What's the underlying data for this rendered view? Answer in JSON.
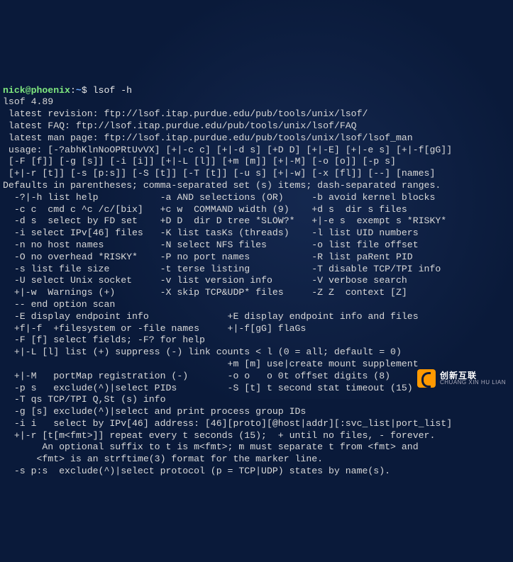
{
  "prompt": {
    "user": "nick@phoenix",
    "sep": ":",
    "path": "~",
    "sigil": "$ ",
    "command": "lsof -h"
  },
  "lines": [
    "lsof 4.89",
    " latest revision: ftp://lsof.itap.purdue.edu/pub/tools/unix/lsof/",
    " latest FAQ: ftp://lsof.itap.purdue.edu/pub/tools/unix/lsof/FAQ",
    " latest man page: ftp://lsof.itap.purdue.edu/pub/tools/unix/lsof/lsof_man",
    " usage: [-?abhKlnNoOPRtUvVX] [+|-c c] [+|-d s] [+D D] [+|-E] [+|-e s] [+|-f[gG]]",
    " [-F [f]] [-g [s]] [-i [i]] [+|-L [l]] [+m [m]] [+|-M] [-o [o]] [-p s]",
    " [+|-r [t]] [-s [p:s]] [-S [t]] [-T [t]] [-u s] [+|-w] [-x [fl]] [--] [names]",
    "Defaults in parentheses; comma-separated set (s) items; dash-separated ranges.",
    "  -?|-h list help           -a AND selections (OR)     -b avoid kernel blocks",
    "  -c c  cmd c ^c /c/[bix]   +c w  COMMAND width (9)    +d s  dir s files",
    "  -d s  select by FD set    +D D  dir D tree *SLOW?*   +|-e s  exempt s *RISKY*",
    "  -i select IPv[46] files   -K list tasKs (threads)    -l list UID numbers",
    "  -n no host names          -N select NFS files        -o list file offset",
    "  -O no overhead *RISKY*    -P no port names           -R list paRent PID",
    "  -s list file size         -t terse listing           -T disable TCP/TPI info",
    "  -U select Unix socket     -v list version info       -V verbose search",
    "  +|-w  Warnings (+)        -X skip TCP&UDP* files     -Z Z  context [Z]",
    "  -- end option scan",
    "  -E display endpoint info              +E display endpoint info and files",
    "  +f|-f  +filesystem or -file names     +|-f[gG] flaGs",
    "  -F [f] select fields; -F? for help",
    "  +|-L [l] list (+) suppress (-) link counts < l (0 = all; default = 0)",
    "                                        +m [m] use|create mount supplement",
    "  +|-M   portMap registration (-)       -o o   o 0t offset digits (8)",
    "  -p s   exclude(^)|select PIDs         -S [t] t second stat timeout (15)",
    "  -T qs TCP/TPI Q,St (s) info",
    "  -g [s] exclude(^)|select and print process group IDs",
    "  -i i   select by IPv[46] address: [46][proto][@host|addr][:svc_list|port_list]",
    "  +|-r [t[m<fmt>]] repeat every t seconds (15);  + until no files, - forever.",
    "       An optional suffix to t is m<fmt>; m must separate t from <fmt> and",
    "      <fmt> is an strftime(3) format for the marker line.",
    "  -s p:s  exclude(^)|select protocol (p = TCP|UDP) states by name(s)."
  ],
  "watermark": {
    "cn": "创新互联",
    "en": "CHUANG XIN HU LIAN"
  }
}
